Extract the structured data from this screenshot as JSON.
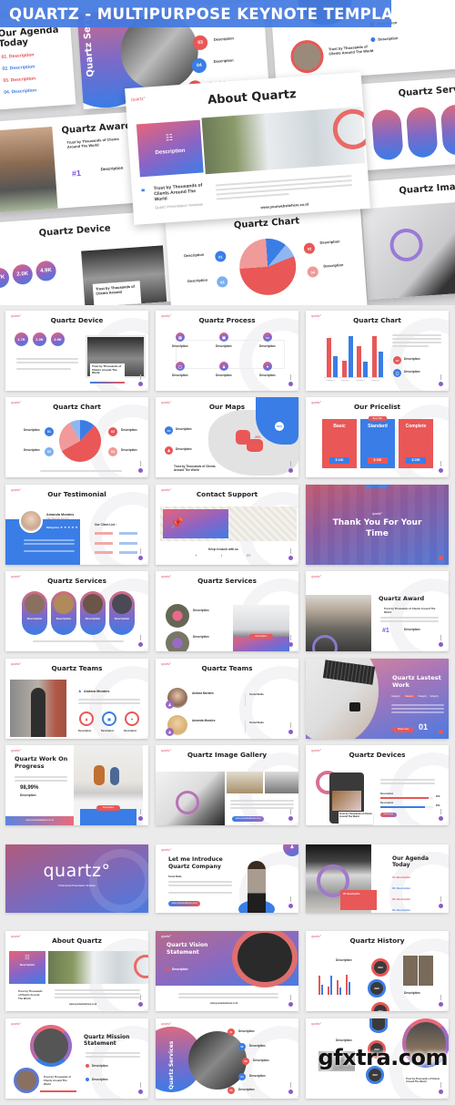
{
  "banner": {
    "title": "QUARTZ - MULTIPURPOSE KEYNOTE TEMPLATE",
    "color": "#4278E1"
  },
  "brand": {
    "logo": "quartz°",
    "accent_red": "#E95757",
    "accent_blue": "#3A7DE6",
    "accent_purple": "#8A5CC6"
  },
  "hero": {
    "agenda": {
      "title": "Our Agenda Today",
      "items": [
        "01. Description",
        "02. Description",
        "03. Description",
        "04. Description"
      ]
    },
    "services": {
      "title": "Quartz Services",
      "numbers": [
        "03",
        "04",
        "05"
      ],
      "item_label": "Description"
    },
    "mission": {
      "title": "Statement",
      "trust": "Trust by Thousands of Clients Around The World",
      "item_label": "Description"
    },
    "award": {
      "title": "Quartz Award",
      "trust": "Trust by Thousands of Clients Around The World",
      "badge": "#1",
      "item_label": "Description"
    },
    "about": {
      "title": "About Quartz",
      "card_label": "Description",
      "trust": "Trust by Thousands of Clients Around The World",
      "trust_sub": "Quartz Presentation Template",
      "url": "www.yourwebsitehere.co.id"
    },
    "services_right": {
      "title": "Quartz Serv",
      "item_label": "Description"
    },
    "image": {
      "title": "Quartz Imag"
    },
    "device": {
      "title": "Quartz Device",
      "stats": [
        "1.7K",
        "2.0K",
        "4.9K"
      ],
      "stat_label": "Description",
      "trust": "Trust by Thousands of Clients Around"
    },
    "chart": {
      "title": "Quartz Chart",
      "item_label": "Description",
      "left_numbers": [
        "01",
        "03"
      ],
      "right_numbers": [
        "02",
        "04"
      ]
    }
  },
  "slides": [
    {
      "title": "Quartz Device",
      "stats": [
        "1.7K",
        "2.0K",
        "4.9K"
      ],
      "stat_label": "Description",
      "trust": "Trust by Thousands of Clients Around The World"
    },
    {
      "title": "Quartz Process",
      "step_label": "Description"
    },
    {
      "title": "Quartz Chart",
      "item_label": "Description"
    },
    {
      "title": "Quartz Chart",
      "item_label": "Description",
      "left_numbers": [
        "01",
        "03"
      ],
      "right_numbers": [
        "02",
        "04"
      ]
    },
    {
      "title": "Our Maps",
      "item_label": "Description",
      "trust": "Trust by Thousands of Clients Around The World",
      "pin_blue": "52%",
      "pin_red": "29%"
    },
    {
      "title": "Our Pricelist",
      "badge": "Best offer",
      "plans": [
        {
          "name": "Basic",
          "price": "$ 120"
        },
        {
          "name": "Standard",
          "price": "$ 190"
        },
        {
          "name": "Complete",
          "price": "$ 259"
        }
      ]
    },
    {
      "title": "Our Testimonial",
      "name": "Amanda Morales",
      "role": "CEO Marylan Foronre",
      "rating_label": "Rating Here",
      "clients_label": "Our Client List :"
    },
    {
      "title": "Contact Support",
      "keep_in_touch": "Keep in touch with us"
    },
    {
      "title": "Thank You For Your Time"
    },
    {
      "title": "Quartz Services",
      "item_label": "Description"
    },
    {
      "title": "Quartz Services",
      "item_label": "Description"
    },
    {
      "title": "Quartz Award",
      "trust": "Trust by Thousands of Clients Around The World",
      "badge": "#1",
      "item_label": "Description"
    },
    {
      "title": "Quartz Teams",
      "name": "Andara Morales",
      "item_label": "Description"
    },
    {
      "title": "Quartz Teams",
      "members": [
        "Andara Morales",
        "Amanda Morales"
      ],
      "social_label": "Social Media"
    },
    {
      "title": "Quartz Lastest Work",
      "tabs": [
        "Category",
        "Category",
        "Category",
        "Category"
      ],
      "button": "Read more",
      "number": "01"
    },
    {
      "title": "Quartz Work On Progress",
      "percent": "98,99%",
      "item_label": "Description",
      "button": "Description",
      "url": "www.yourwebsitehere.co.id"
    },
    {
      "title": "Quartz Image Gallery",
      "url": "www.yourwebsitehere.co.id"
    },
    {
      "title": "Quartz Devices",
      "bars": [
        {
          "label": "Description",
          "value": 0.92,
          "pct": "90%"
        },
        {
          "label": "Description",
          "value": 0.85,
          "pct": "80%"
        }
      ],
      "trust": "Trust by Thousands of Clients Around The World",
      "button": "Read more"
    },
    {
      "title": "quartz°",
      "subtitle": "Professional Presentation Template"
    },
    {
      "title": "Let me Introduce Quartz Company",
      "social_label": "Social Media",
      "url": "www.yourwebsitehere.co.id"
    },
    {
      "title": "Our Agenda Today",
      "items": [
        "01. Description",
        "02. Description",
        "03. Description",
        "04. Description"
      ],
      "highlight": "05. Description"
    },
    {
      "title": "About Quartz",
      "card_label": "Description",
      "trust": "Trust by Thousands of Clients Around The World",
      "url": "www.yourwebsitehere.co.id"
    },
    {
      "title": "Quartz Vision Statement",
      "item_label": "Description",
      "url": "www.yourwebsitehere.co.id"
    },
    {
      "title": "Quartz History",
      "item_label": "Description",
      "years": [
        "2019",
        "2020",
        "2021"
      ]
    },
    {
      "title": "Quartz Mission Statement",
      "item_label": "Description",
      "trust": "Trust by Thousands of Clients Around The World"
    },
    {
      "title": "Quartz Services",
      "numbers": [
        "01",
        "02",
        "03",
        "04",
        "05"
      ],
      "item_label": "Description"
    },
    {
      "title": "Quartz History",
      "item_label": "Description",
      "trust": "Trust by Thousands of Clients Around The World",
      "years": [
        "2022",
        "2023"
      ]
    }
  ],
  "chart_data": [
    {
      "type": "bar",
      "title": "Quartz Chart",
      "categories": [
        "Category 1",
        "Category 2",
        "Category 3",
        "Category 4"
      ],
      "series": [
        {
          "name": "Description",
          "color": "#E95757",
          "values": [
            9.5,
            4.0,
            7.5,
            10.0
          ]
        },
        {
          "name": "Description",
          "color": "#3A7DE6",
          "values": [
            5.0,
            9.8,
            3.8,
            6.2
          ]
        }
      ],
      "ylim": [
        0,
        11
      ]
    },
    {
      "type": "pie",
      "title": "Quartz Chart",
      "labels": [
        "01",
        "02",
        "03",
        "04"
      ],
      "values": [
        12,
        55,
        25,
        8
      ],
      "colors": [
        "#3A7DE6",
        "#E95757",
        "#F09A9A",
        "#8FB6F0"
      ]
    }
  ],
  "watermark": "gfxtra.com"
}
